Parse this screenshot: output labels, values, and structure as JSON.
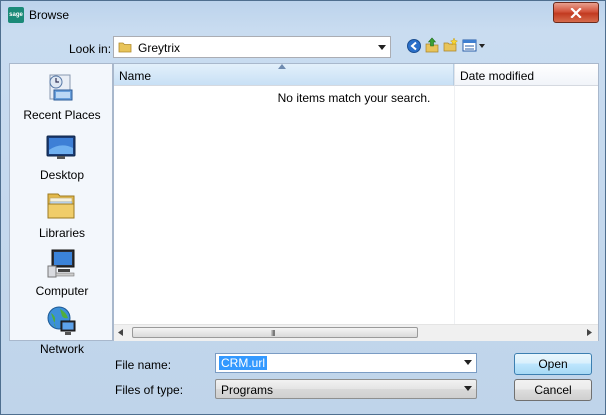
{
  "window": {
    "title": "Browse",
    "app_icon_text": "sage",
    "close_icon": "close-icon"
  },
  "look_in": {
    "label": "Look in:",
    "value": "Greytrix",
    "toolbar_icons": [
      "back-icon",
      "up-folder-icon",
      "new-folder-icon",
      "view-menu-icon"
    ]
  },
  "places": [
    {
      "label": "Recent Places",
      "icon": "recent-places-icon"
    },
    {
      "label": "Desktop",
      "icon": "desktop-icon"
    },
    {
      "label": "Libraries",
      "icon": "libraries-icon"
    },
    {
      "label": "Computer",
      "icon": "computer-icon"
    },
    {
      "label": "Network",
      "icon": "network-icon"
    }
  ],
  "file_list": {
    "columns": [
      "Name",
      "Date modified"
    ],
    "empty_message": "No items match your search.",
    "scroll_grip": "III"
  },
  "file_name": {
    "label": "File name:",
    "value": "CRM.url"
  },
  "file_type": {
    "label": "Files of type:",
    "value": "Programs"
  },
  "buttons": {
    "open": "Open",
    "cancel": "Cancel"
  },
  "colors": {
    "frame": "#bfd4ea",
    "close_button": "#c23a20",
    "selection": "#3399ff"
  }
}
